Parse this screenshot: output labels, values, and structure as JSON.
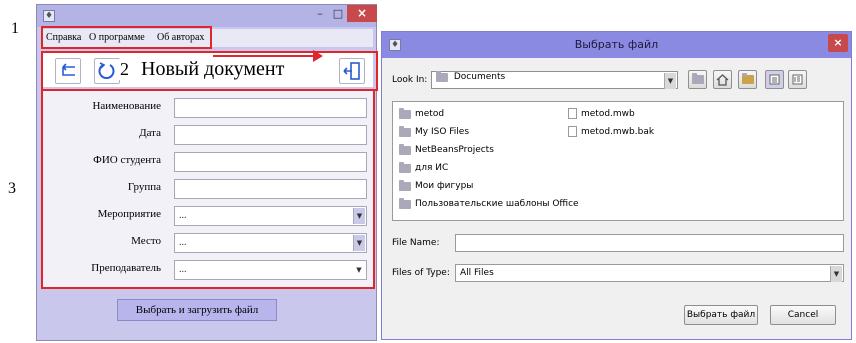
{
  "markers": [
    "1",
    "2",
    "3"
  ],
  "main_window": {
    "menu": [
      "Справка",
      "О программе",
      "Об авторах"
    ],
    "title": "Новый документ",
    "fields": [
      {
        "label": "Наименование"
      },
      {
        "label": "Дата"
      },
      {
        "label": "ФИО студента"
      },
      {
        "label": "Группа"
      }
    ],
    "combos": [
      {
        "label": "Мероприятие",
        "value": "..."
      },
      {
        "label": "Место",
        "value": "..."
      },
      {
        "label": "Преподаватель",
        "value": "..."
      }
    ],
    "load_button": "Выбрать и загрузить файл"
  },
  "file_dialog": {
    "title": "Выбрать файл",
    "look_in_label": "Look In:",
    "look_in_value": "Documents",
    "folders": [
      "metod",
      "My ISO Files",
      "NetBeansProjects",
      "для ИС",
      "Мои фигуры",
      "Пользовательские шаблоны Office"
    ],
    "files": [
      "metod.mwb",
      "metod.mwb.bak"
    ],
    "file_name_label": "File Name:",
    "file_name_value": "",
    "files_of_type_label": "Files of Type:",
    "files_of_type_value": "All Files",
    "select_button": "Выбрать файл",
    "cancel_button": "Cancel"
  },
  "colors": {
    "highlight_red": "#e0262c",
    "window_lavender": "#c9c8ec",
    "dialog_titlebar": "#8b8ae2",
    "close_button": "#c7494b"
  },
  "icons": [
    "app-icon",
    "minimize-icon",
    "maximize-icon",
    "close-icon",
    "back-arrow-icon",
    "refresh-icon",
    "exit-door-icon",
    "combo-arrow-icon",
    "up-folder-icon",
    "home-icon",
    "new-folder-icon",
    "list-view-icon",
    "details-view-icon",
    "folder-icon",
    "file-icon"
  ]
}
